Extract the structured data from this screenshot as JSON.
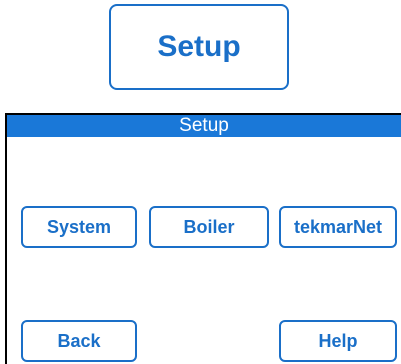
{
  "top_button": {
    "label": "Setup"
  },
  "screen": {
    "title": "Setup",
    "buttons": {
      "system": "System",
      "boiler": "Boiler",
      "tekmarnet": "tekmarNet",
      "back": "Back",
      "help": "Help"
    }
  },
  "colors": {
    "accent": "#1a6fc8",
    "titlebar": "#1a78d8",
    "title_text": "#ffffff",
    "frame": "#000000"
  }
}
